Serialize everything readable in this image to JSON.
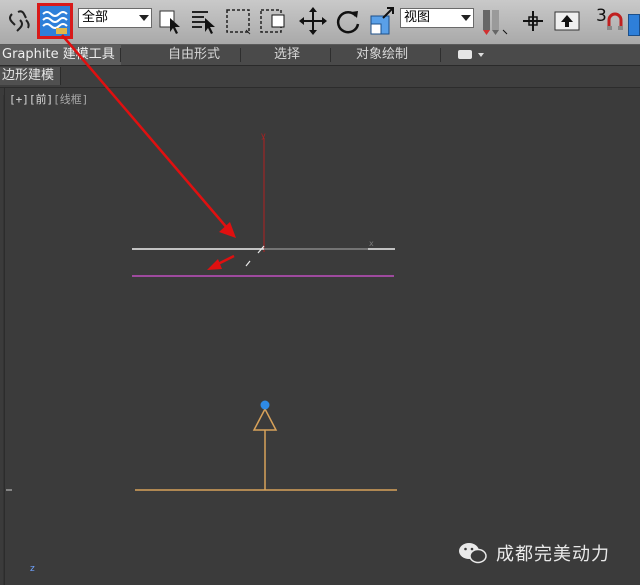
{
  "colors": {
    "toolbar_bg": "#b9b9b9",
    "viewport_bg": "#3b3b3b",
    "highlight": "#d81a1a",
    "annotation_arrow": "#e01010",
    "line_white": "#f0f0f0",
    "line_magenta": "#c050c0",
    "line_orange": "#d8a25a",
    "axis_red": "#b02020",
    "gizmo_blue": "#2e8ae6"
  },
  "toolbar": {
    "icons": [
      "link-icon",
      "bind-spacewarp-icon",
      "select-object-icon",
      "select-by-name-icon",
      "rectangular-selection-icon",
      "window-crossing-icon",
      "move-icon",
      "rotate-icon",
      "scale-icon",
      "use-pivot-icon",
      "select-manipulate-icon",
      "keyboard-shortcut-icon",
      "snap-toggle-icon"
    ],
    "selection_filter": "全部",
    "reference_coord": "视图",
    "snap_label": "3"
  },
  "ribbon": {
    "tabs": [
      "Graphite 建模工具",
      "自由形式",
      "选择",
      "对象绘制"
    ],
    "subtab": "多边形建模",
    "subtab_visible": "边形建模"
  },
  "viewport": {
    "label": {
      "plus": "[+]",
      "view": "[前]",
      "shading": "[线框]"
    },
    "axis_x": "x",
    "axis_y": "y",
    "axis_z": "z"
  },
  "watermark": {
    "icon": "wechat-icon",
    "text": "成都完美动力"
  }
}
